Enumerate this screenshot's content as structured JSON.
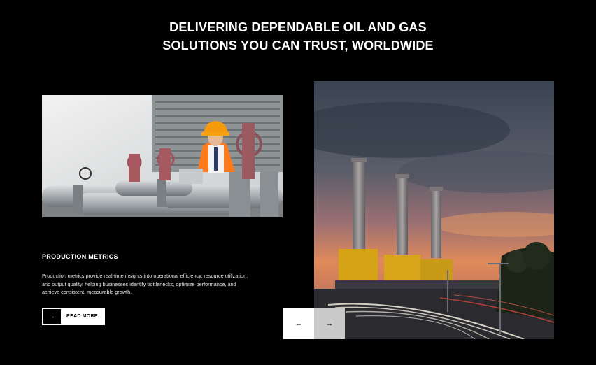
{
  "hero": {
    "headline": "DELIVERING DEPENDABLE OIL AND GAS SOLUTIONS YOU CAN TRUST, WORLDWIDE"
  },
  "feature": {
    "title": "PRODUCTION METRICS",
    "description": "Production metrics provide real-time insights into operational efficiency, resource utilization, and output quality, helping businesses identify bottlenecks, optimize performance, and achieve consistent, measurable growth.",
    "read_more_label": "READ MORE",
    "read_more_icon": "→"
  },
  "carousel": {
    "prev_icon": "←",
    "next_icon": "→"
  },
  "colors": {
    "background": "#000000",
    "text": "#ffffff",
    "nav_active": "#ffffff",
    "nav_inactive": "#c9c9c9"
  }
}
